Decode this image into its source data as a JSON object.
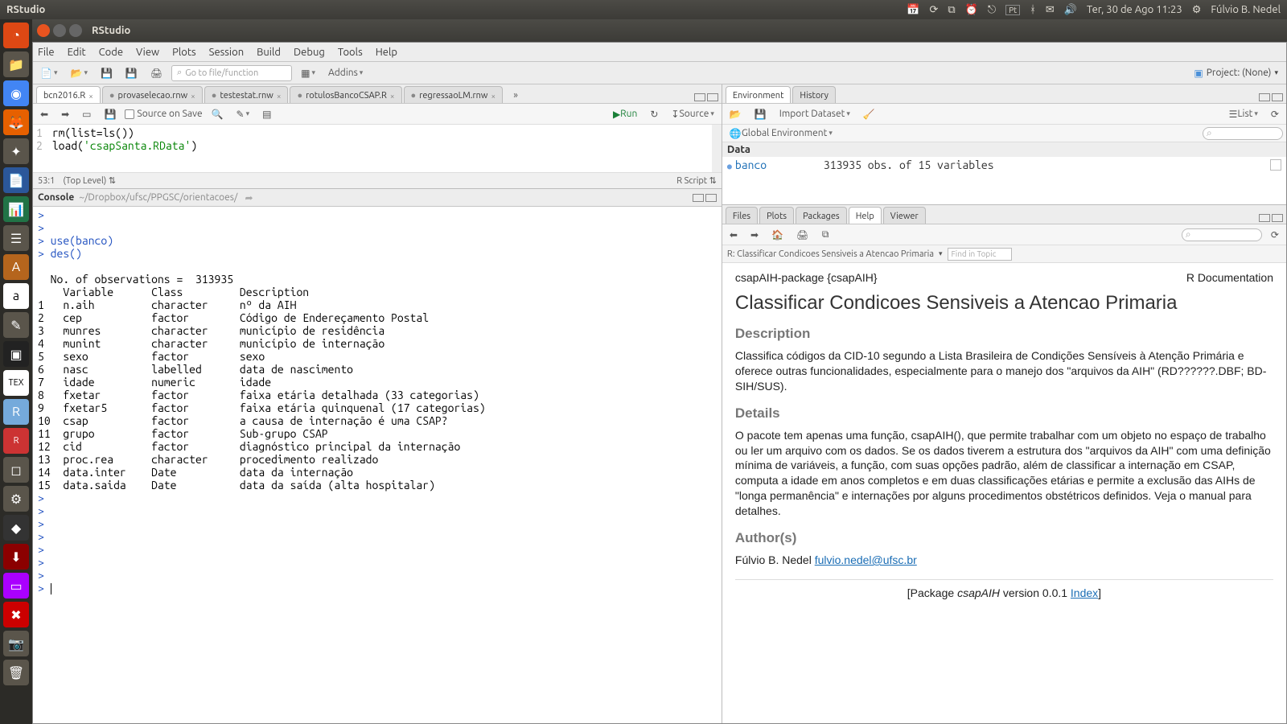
{
  "os": {
    "app_name": "RStudio",
    "clock": "Ter, 30 de Ago 11:23",
    "user": "Fúlvio B. Nedel",
    "tray_icons": [
      "calendar-icon",
      "update-icon",
      "dropbox-icon",
      "clock-icon",
      "wifi-icon",
      "keyboard-icon",
      "bluetooth-icon",
      "mail-icon",
      "sound-icon",
      "gear-icon"
    ],
    "keyboard_layout": "Pt"
  },
  "window": {
    "title": "RStudio"
  },
  "menubar": [
    "File",
    "Edit",
    "Code",
    "View",
    "Plots",
    "Session",
    "Build",
    "Debug",
    "Tools",
    "Help"
  ],
  "maintoolbar": {
    "goto_placeholder": "Go to file/function",
    "addins": "Addins",
    "project": "Project: (None)"
  },
  "source": {
    "tabs": [
      {
        "label": "bcn2016.R",
        "active": true
      },
      {
        "label": "provaselecao.rnw"
      },
      {
        "label": "testestat.rnw"
      },
      {
        "label": "rotulosBancoCSAP.R"
      },
      {
        "label": "regressaoLM.rnw"
      }
    ],
    "source_on_save": "Source on Save",
    "run": "Run",
    "source_btn": "Source",
    "lines": [
      {
        "n": "1",
        "text": "rm(list=ls())"
      },
      {
        "n": "2",
        "text": "load('csapSanta.RData')"
      }
    ],
    "status_pos": "53:1",
    "status_scope": "(Top Level)",
    "status_lang": "R Script"
  },
  "console": {
    "title": "Console",
    "path": "~/Dropbox/ufsc/PPGSC/orientacoes/",
    "lines": [
      {
        "t": "p",
        "text": ">"
      },
      {
        "t": "p",
        "text": ">"
      },
      {
        "t": "c",
        "text": "> use(banco)"
      },
      {
        "t": "c",
        "text": "> des()"
      },
      {
        "t": "b",
        "text": ""
      },
      {
        "t": "o",
        "text": "  No. of observations =  313935"
      },
      {
        "t": "o",
        "text": "    Variable      Class         Description"
      },
      {
        "t": "o",
        "text": "1   n.aih         character     nº da AIH"
      },
      {
        "t": "o",
        "text": "2   cep           factor        Código de Endereçamento Postal"
      },
      {
        "t": "o",
        "text": "3   munres        character     município de residência"
      },
      {
        "t": "o",
        "text": "4   munint        character     município de internação"
      },
      {
        "t": "o",
        "text": "5   sexo          factor        sexo"
      },
      {
        "t": "o",
        "text": "6   nasc          labelled      data de nascimento"
      },
      {
        "t": "o",
        "text": "7   idade         numeric       idade"
      },
      {
        "t": "o",
        "text": "8   fxetar        factor        faixa etária detalhada (33 categorias)"
      },
      {
        "t": "o",
        "text": "9   fxetar5       factor        faixa etária quinquenal (17 categorias)"
      },
      {
        "t": "o",
        "text": "10  csap          factor        a causa de internação é uma CSAP?"
      },
      {
        "t": "o",
        "text": "11  grupo         factor        Sub-grupo CSAP"
      },
      {
        "t": "o",
        "text": "12  cid           factor        diagnóstico principal da internação"
      },
      {
        "t": "o",
        "text": "13  proc.rea      character     procedimento realizado"
      },
      {
        "t": "o",
        "text": "14  data.inter    Date          data da internação"
      },
      {
        "t": "o",
        "text": "15  data.saida    Date          data da saída (alta hospitalar)"
      },
      {
        "t": "p",
        "text": ">"
      },
      {
        "t": "p",
        "text": ">"
      },
      {
        "t": "p",
        "text": ">"
      },
      {
        "t": "p",
        "text": ">"
      },
      {
        "t": "p",
        "text": ">"
      },
      {
        "t": "p",
        "text": ">"
      },
      {
        "t": "p",
        "text": ">"
      },
      {
        "t": "cursor",
        "text": "> "
      }
    ]
  },
  "environment": {
    "tabs": [
      "Environment",
      "History"
    ],
    "active_tab": 0,
    "import": "Import Dataset",
    "scope": "Global Environment",
    "view": "List",
    "section": "Data",
    "items": [
      {
        "name": "banco",
        "desc": "313935 obs. of 15 variables"
      }
    ]
  },
  "help": {
    "tabs": [
      "Files",
      "Plots",
      "Packages",
      "Help",
      "Viewer"
    ],
    "active_tab": 3,
    "breadcrumb": "R: Classificar Condicoes Sensiveis a Atencao Primaria",
    "find_placeholder": "Find in Topic",
    "pkg": "csapAIH-package {csapAIH}",
    "doc_label": "R Documentation",
    "title": "Classificar Condicoes Sensiveis a Atencao Primaria",
    "h_description": "Description",
    "p_description": "Classifica códigos da CID-10 segundo a Lista Brasileira de Condições Sensíveis à Atenção Primária e oferece outras funcionalidades, especialmente para o manejo dos \"arquivos da AIH\" (RD??????.DBF; BD-SIH/SUS).",
    "h_details": "Details",
    "p_details": "O pacote tem apenas uma função, csapAIH(), que permite trabalhar com um objeto no espaço de trabalho ou ler um arquivo com os dados. Se os dados tiverem a estrutura dos \"arquivos da AIH\" com uma definição mínima de variáveis, a função, com suas opções padrão, além de classificar a internação em CSAP, computa a idade em anos completos e em duas classificações etárias e permite a exclusão das AIHs de \"longa permanência\" e internações por alguns procedimentos obstétricos definidos. Veja o manual para detalhes.",
    "h_authors": "Author(s)",
    "author_name": "Fúlvio B. Nedel ",
    "author_email": "fulvio.nedel@ufsc.br",
    "footer_prefix": "[Package ",
    "footer_pkg": "csapAIH",
    "footer_version": " version 0.0.1 ",
    "footer_index": "Index",
    "footer_suffix": "]"
  }
}
